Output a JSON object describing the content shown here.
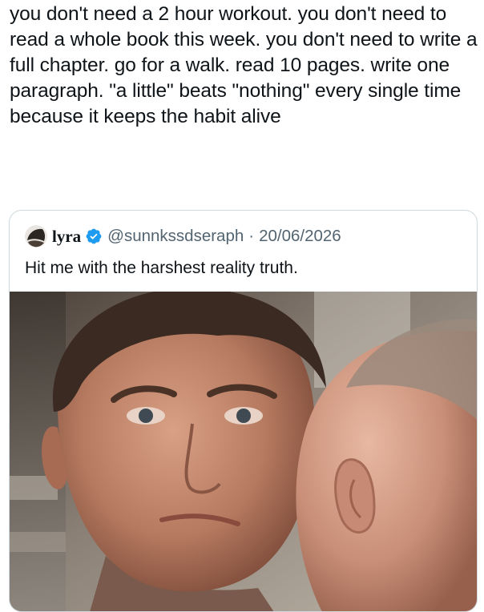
{
  "post": {
    "text": "you don't need a 2 hour workout. you don't need to read a whole book this week. you don't need to write a full chapter. go for a walk. read 10 pages. write one paragraph. \"a little\" beats \"nothing\" every single time because it keeps the habit alive"
  },
  "quoted_post": {
    "display_name": "lyra",
    "handle": "@sunnkssdseraph",
    "separator": "·",
    "date": "20/06/2026",
    "text": "Hit me with the harshest reality truth.",
    "verified": true,
    "media_icon": "photo-two-men-whisper"
  },
  "colors": {
    "text": "#0f1419",
    "muted": "#536471",
    "border": "#cfd9de",
    "verified_blue": "#1d9bf0"
  }
}
